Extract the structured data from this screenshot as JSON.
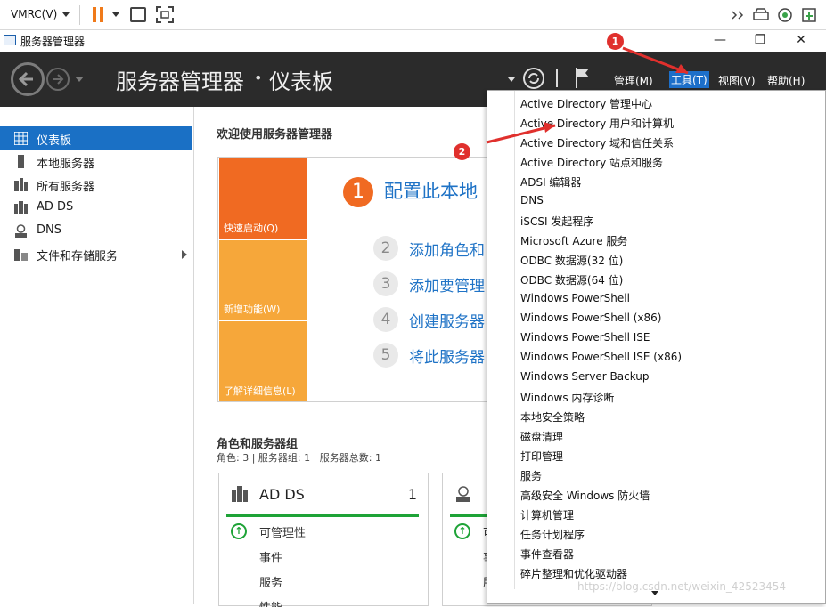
{
  "vmrc": {
    "menu_label": "VMRC(V)"
  },
  "window": {
    "title": "服务器管理器",
    "minimize": "—",
    "restore": "❐",
    "close": "✕"
  },
  "header": {
    "breadcrumb_app": "服务器管理器",
    "breadcrumb_sep": "•",
    "breadcrumb_page": "仪表板",
    "menus": [
      "管理(M)",
      "工具(T)",
      "视图(V)",
      "帮助(H)"
    ]
  },
  "sidebar": {
    "items": [
      {
        "label": "仪表板",
        "icon": "dashboard-icon",
        "active": true
      },
      {
        "label": "本地服务器",
        "icon": "server-icon"
      },
      {
        "label": "所有服务器",
        "icon": "servers-icon"
      },
      {
        "label": "AD DS",
        "icon": "ad-ds-icon"
      },
      {
        "label": "DNS",
        "icon": "dns-icon"
      },
      {
        "label": "文件和存储服务",
        "icon": "file-storage-icon",
        "has_submenu": true
      }
    ]
  },
  "main": {
    "welcome_title": "欢迎使用服务器管理器",
    "tiles": [
      "快速启动(Q)",
      "新增功能(W)",
      "了解详细信息(L)"
    ],
    "step1": {
      "num": "1",
      "text": "配置此本地"
    },
    "steps": [
      {
        "num": "2",
        "text": "添加角色和"
      },
      {
        "num": "3",
        "text": "添加要管理"
      },
      {
        "num": "4",
        "text": "创建服务器"
      },
      {
        "num": "5",
        "text": "将此服务器"
      }
    ],
    "roles_title": "角色和服务器组",
    "roles_sub": "角色: 3 | 服务器组: 1 | 服务器总数: 1",
    "card1": {
      "name": "AD DS",
      "count": "1",
      "lines": [
        "可管理性",
        "事件",
        "服务",
        "性能"
      ]
    },
    "card2": {
      "lines": [
        "可",
        "事",
        "服"
      ]
    }
  },
  "tools_menu": {
    "items": [
      "Active Directory 管理中心",
      "Active Directory 用户和计算机",
      "Active Directory 域和信任关系",
      "Active Directory 站点和服务",
      "ADSI 编辑器",
      "DNS",
      "iSCSI 发起程序",
      "Microsoft Azure 服务",
      "ODBC 数据源(32 位)",
      "ODBC 数据源(64 位)",
      "Windows PowerShell",
      "Windows PowerShell (x86)",
      "Windows PowerShell ISE",
      "Windows PowerShell ISE (x86)",
      "Windows Server Backup",
      "Windows 内存诊断",
      "本地安全策略",
      "磁盘清理",
      "打印管理",
      "服务",
      "高级安全 Windows 防火墙",
      "计算机管理",
      "任务计划程序",
      "事件查看器",
      "碎片整理和优化驱动器"
    ]
  },
  "annotations": {
    "marker1": "1",
    "marker2": "2",
    "color": "#e0302d"
  },
  "watermark": "https://blog.csdn.net/weixin_42523454",
  "colors": {
    "header_bg": "#2b2b2b",
    "accent_blue": "#1a70c5",
    "tile_orange": "#f06a22",
    "tile_light": "#f6a73a",
    "status_green": "#1ea337"
  }
}
